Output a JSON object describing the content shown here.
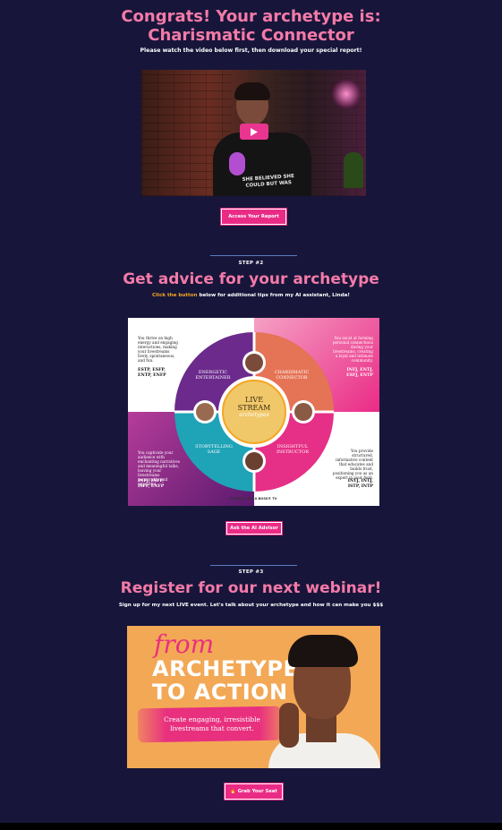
{
  "hero": {
    "title_line1": "Congrats! Your archetype is:",
    "title_line2": "Charismatic Connector",
    "subtitle": "Please watch the video below first, then download your special report!",
    "video_shirt_text": "SHE BELIEVED SHE COULD BUT WAS",
    "report_button": "Access Your Report"
  },
  "step2": {
    "label": "STEP #2",
    "title": "Get advice for your archetype",
    "sub_highlight": "Click the button",
    "sub_rest": " below for additional tips from my AI assistant, Linda!",
    "button": "Ask the AI Advisor",
    "wheel": {
      "center_line1": "LIVE",
      "center_line2": "STREAM",
      "center_line3": "archetypes",
      "footer": "STREAM LIKE A BOSS® TV",
      "quadrants": [
        {
          "name_l1": "ENERGETIC",
          "name_l2": "ENTERTAINER",
          "desc": "You thrive on high energy and engaging interactions, making your livestreams lively, spontaneous, and fun.",
          "types": "ESTP, ESFP, ENTP, ENFP"
        },
        {
          "name_l1": "CHARISMATIC",
          "name_l2": "CONNECTOR",
          "desc": "You excel at forming personal connections during your livestreams, creating a loyal and intimate community.",
          "types": "INFJ, ENTJ, ESFJ, ENTP"
        },
        {
          "name_l1": "STORYTELLING",
          "name_l2": "SAGE",
          "desc": "You captivate your audience with enchanting narratives and meaningful talks, leaving your livestreams memorable and impactful.",
          "types": "INFJ, INFP, ISFP, ENFP"
        },
        {
          "name_l1": "INSIGHTFUL",
          "name_l2": "INSTRUCTOR",
          "desc": "You provide structured, informative content that educates and builds trust, positioning you as an expert in your field.",
          "types": "INTJ, INTJ, ISTP, INTP"
        }
      ]
    }
  },
  "step3": {
    "label": "STEP #3",
    "title": "Register for our next webinar!",
    "subtitle": "Sign up for my next LIVE event. Let's talk about your archetype and how it can make you $$$",
    "banner_from": "from",
    "banner_title_l1": "ARCHETYPE",
    "banner_title_l2": "TO ACTION",
    "banner_tagline_l1": "Create engaging, irresistible",
    "banner_tagline_l2": "livestreams that convert.",
    "button": "Grab Your Seat"
  },
  "colors": {
    "background": "#17163a",
    "accent_pink": "#f47aa8",
    "button": "#ea2b86",
    "highlight_orange": "#f5a623"
  }
}
